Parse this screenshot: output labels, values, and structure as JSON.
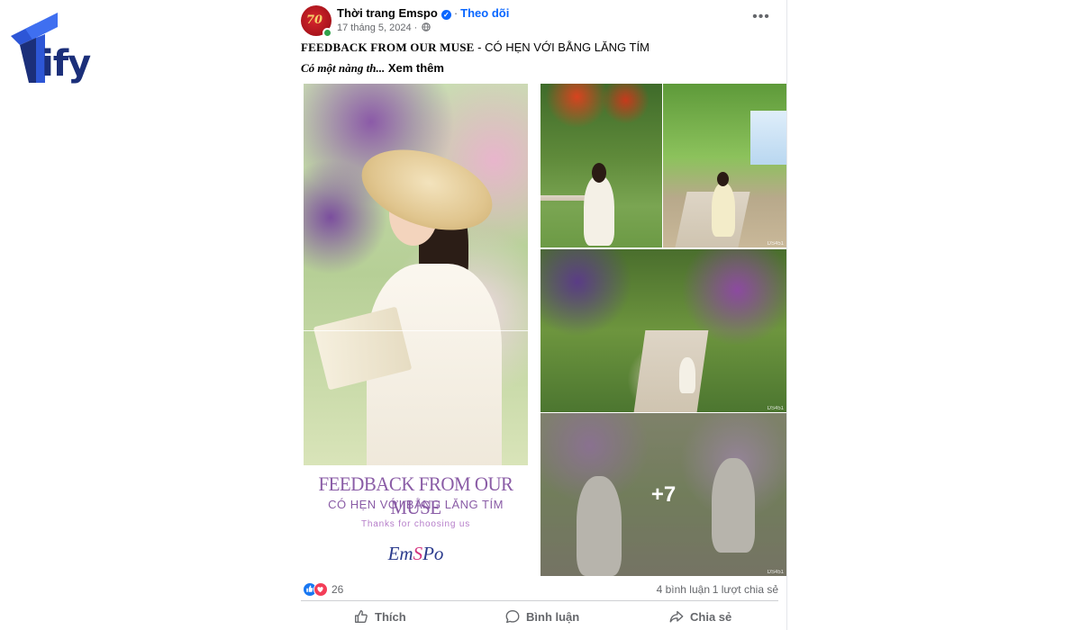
{
  "watermark": {
    "text": "ify",
    "color": "#1b2f7a"
  },
  "post": {
    "page_name": "Thời trang Emspo",
    "separator": "·",
    "follow_label": "Theo dõi",
    "date": "17 tháng 5, 2024 ·",
    "avatar_text": "70",
    "more_label": "•••",
    "caption_heading": "FEEDBACK FROM OUR MUSE",
    "caption_heading_rest": " - CÓ HẸN VỚI BẰNG LĂNG TÍM",
    "caption_snippet": "Có một nàng th...",
    "see_more": "Xem thêm",
    "big_image": {
      "title": "FEEDBACK FROM OUR MUSE",
      "subtitle": "CÓ HẸN VỚI BẰNG LĂNG TÍM",
      "thanks": "Thanks for choosing us",
      "brand_part1": "Em",
      "brand_part2": "S",
      "brand_part3": "Po"
    },
    "tile_tag": "DS451",
    "more_photos": "+7",
    "reactions_count": "26",
    "comments": "4 bình luận",
    "shares": "1 lượt chia sẻ",
    "actions": {
      "like": "Thích",
      "comment": "Bình luận",
      "share": "Chia sẻ"
    }
  },
  "colors": {
    "accent": "#0866ff",
    "muted": "#65676b",
    "like": "#1877f2",
    "love": "#f33e58"
  }
}
